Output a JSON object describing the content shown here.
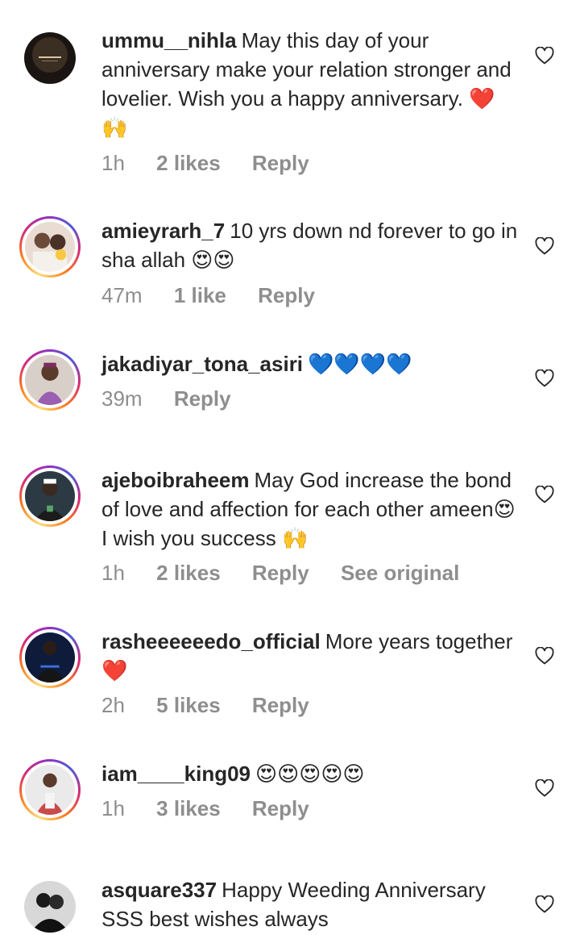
{
  "comments": [
    {
      "username": "ummu__nihla",
      "text": "May this day of your anniversary make your relation stronger and lovelier. Wish you a happy anniversary. ❤️🙌",
      "time": "1h",
      "likes": "2 likes",
      "reply": "Reply",
      "extra": ""
    },
    {
      "username": "amieyrarh_7",
      "text": "10 yrs down nd forever to go in sha allah 😍😍",
      "time": "47m",
      "likes": "1 like",
      "reply": "Reply",
      "extra": ""
    },
    {
      "username": "jakadiyar_tona_asiri",
      "text": "💙💙💙💙",
      "time": "39m",
      "likes": "",
      "reply": "Reply",
      "extra": ""
    },
    {
      "username": "ajeboibraheem",
      "text": "May God increase the bond of love and affection for each other ameen😍 I wish you success 🙌",
      "time": "1h",
      "likes": "2 likes",
      "reply": "Reply",
      "extra": "See original"
    },
    {
      "username": "rasheeeeeedo_official",
      "text": "More years together ❤️",
      "time": "2h",
      "likes": "5 likes",
      "reply": "Reply",
      "extra": ""
    },
    {
      "username": "iam____king09",
      "text": "😍😍😍😍😍",
      "time": "1h",
      "likes": "3 likes",
      "reply": "Reply",
      "extra": ""
    },
    {
      "username": "asquare337",
      "text": "Happy Weeding Anniversary SSS best wishes always",
      "time": "",
      "likes": "",
      "reply": "",
      "extra": ""
    }
  ],
  "icons": {
    "like": "heart-outline-icon"
  },
  "colors": {
    "text": "#262626",
    "meta": "#8e8e8e",
    "heart": "#262626"
  }
}
